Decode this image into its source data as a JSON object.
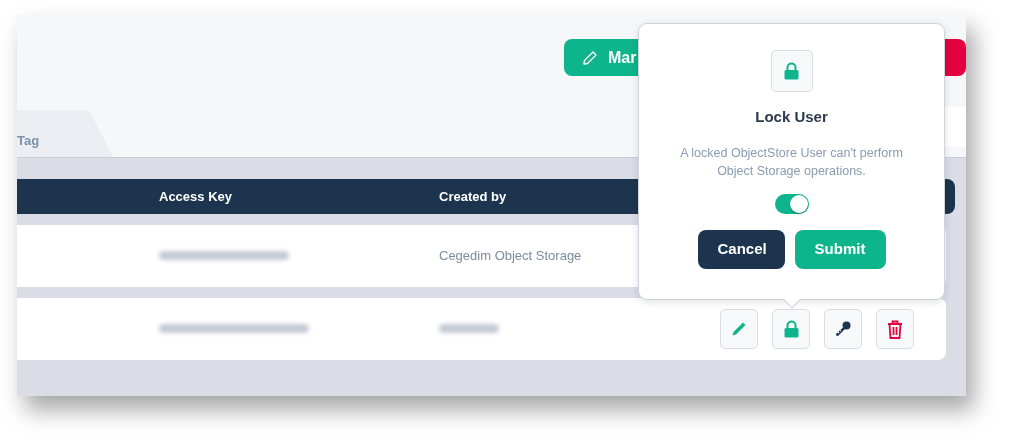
{
  "header_actions": [
    {
      "label": "Mar",
      "kind": "edit"
    },
    {
      "kind": "danger"
    }
  ],
  "tabs": [
    {
      "label": "Tag",
      "selected": false
    }
  ],
  "table": {
    "columns": [
      {
        "label": "Access Key"
      },
      {
        "label": "Created by"
      }
    ],
    "rows": [
      {
        "cells": [
          {
            "kind": "blurred"
          },
          {
            "kind": "text",
            "text": "Cegedim Object Storage"
          }
        ],
        "actions": []
      },
      {
        "cells": [
          {
            "kind": "blurred"
          },
          {
            "kind": "blurred"
          }
        ],
        "actions": [
          {
            "kind": "edit"
          },
          {
            "kind": "lock"
          },
          {
            "kind": "key"
          },
          {
            "kind": "delete"
          }
        ]
      }
    ]
  },
  "popover": {
    "title": "Lock User",
    "message": "A locked ObjectStore User can't perform Object Storage operations.",
    "toggle": {
      "on": true
    },
    "buttons": [
      {
        "label": "Cancel",
        "kind": "secondary"
      },
      {
        "label": "Submit",
        "kind": "primary"
      }
    ]
  }
}
